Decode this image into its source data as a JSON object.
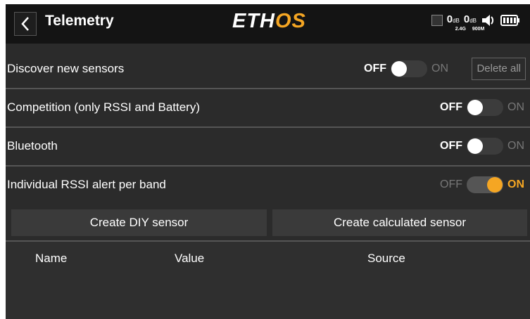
{
  "header": {
    "title": "Telemetry",
    "logo_main": "ETH",
    "logo_accent": "OS",
    "rssi_24": "0",
    "rssi_24_unit": "dB",
    "rssi_24_band": "2.4G",
    "rssi_900": "0",
    "rssi_900_unit": "dB",
    "rssi_900_band": "900M",
    "icons": [
      "back-chevron-icon",
      "module-status-icon",
      "speaker-icon",
      "battery-icon"
    ]
  },
  "rows": [
    {
      "label": "Discover new sensors",
      "off": "OFF",
      "on": "ON",
      "state": "off",
      "button": "Delete all"
    },
    {
      "label": "Competition (only RSSI and Battery)",
      "off": "OFF",
      "on": "ON",
      "state": "off"
    },
    {
      "label": "Bluetooth",
      "off": "OFF",
      "on": "ON",
      "state": "off"
    },
    {
      "label": "Individual RSSI alert per band",
      "off": "OFF",
      "on": "ON",
      "state": "on"
    }
  ],
  "actions": {
    "create_diy": "Create DIY sensor",
    "create_calculated": "Create calculated sensor"
  },
  "table": {
    "columns": [
      "Name",
      "Value",
      "Source"
    ]
  },
  "colors": {
    "accent": "#f5a623",
    "background": "#2b2b2b",
    "header": "#141414"
  }
}
